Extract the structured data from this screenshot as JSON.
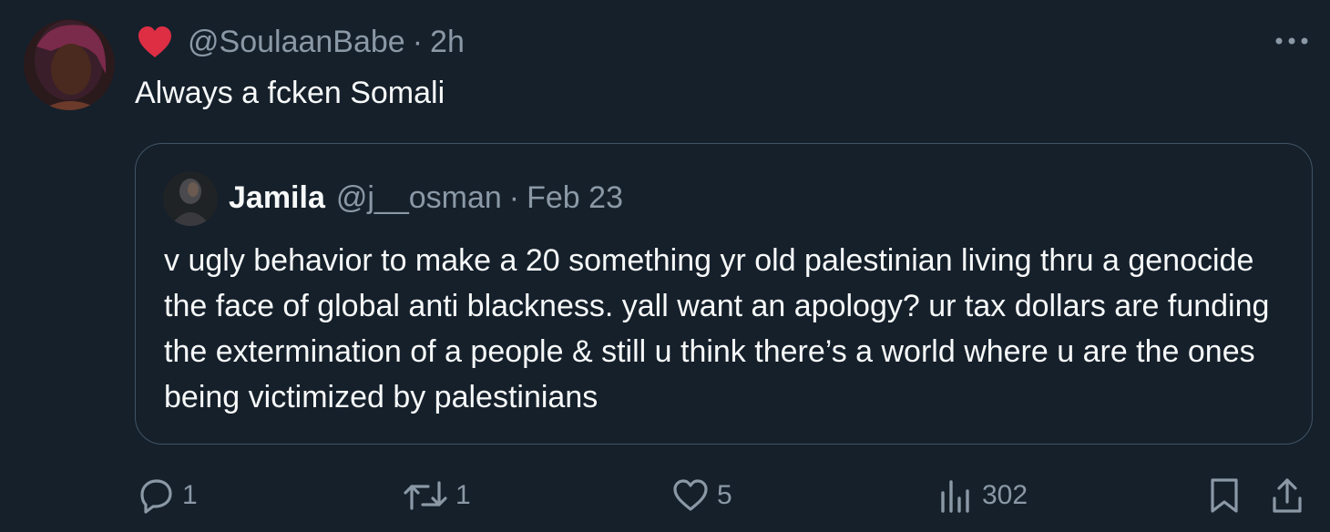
{
  "tweet": {
    "handle": "@SoulaanBabe",
    "separator": "·",
    "time": "2h",
    "text": "Always a fcken Somali",
    "heart_emoji_icon": "red-heart-emoji"
  },
  "quote": {
    "name": "Jamila",
    "handle": "@j__osman",
    "separator": "·",
    "date": "Feb 23",
    "text": "v ugly behavior to make a 20 something yr old palestinian living thru a genocide the face of global anti blackness. yall want an apology? ur tax dollars are funding the extermination of a people & still u think there’s a world where u are the ones being victimized by palestinians"
  },
  "actions": {
    "replies": "1",
    "reposts": "1",
    "likes": "5",
    "views": "302"
  },
  "colors": {
    "background": "#15202b",
    "text": "#f7f9f9",
    "secondary": "#8b98a5",
    "border": "#425364",
    "heart": "#e0245e"
  }
}
